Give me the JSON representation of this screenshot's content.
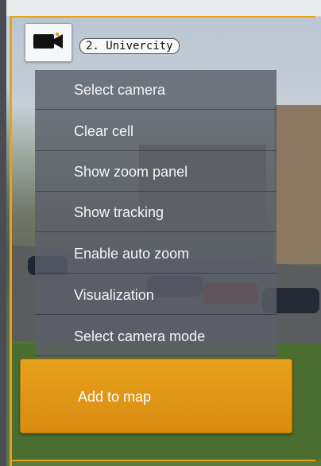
{
  "camera": {
    "icon": "video-camera-icon",
    "label": "2. Univercity"
  },
  "context_menu": {
    "items": [
      {
        "label": "Select camera"
      },
      {
        "label": "Clear cell"
      },
      {
        "label": "Show zoom panel"
      },
      {
        "label": "Show tracking"
      },
      {
        "label": "Enable auto zoom"
      },
      {
        "label": "Visualization"
      },
      {
        "label": "Select camera mode"
      }
    ],
    "primary_action": {
      "label": "Add to map"
    }
  },
  "colors": {
    "accent": "#e5a21b",
    "menu_bg": "#5c5f68",
    "primary_button": "#e09616"
  }
}
